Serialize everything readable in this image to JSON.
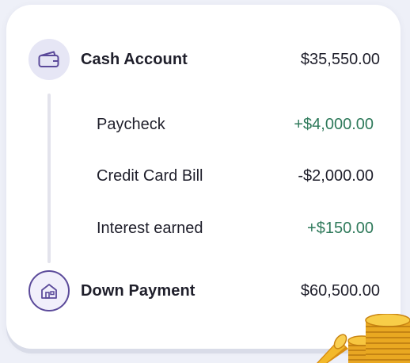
{
  "cash_account": {
    "icon": "wallet-icon",
    "label": "Cash Account",
    "value": "$35,550.00"
  },
  "transactions": [
    {
      "label": "Paycheck",
      "amount": "+$4,000.00",
      "type": "positive"
    },
    {
      "label": "Credit Card Bill",
      "amount": "-$2,000.00",
      "type": "negative"
    },
    {
      "label": "Interest earned",
      "amount": "+$150.00",
      "type": "positive"
    }
  ],
  "down_payment": {
    "icon": "house-icon",
    "label": "Down Payment",
    "value": "$60,500.00"
  },
  "colors": {
    "positive": "#2f7a5b",
    "text": "#1f1f2b",
    "accent": "#5b4a9a",
    "background": "#eef0f8",
    "coin": "#e8a623"
  },
  "decoration": "gold-coins-illustration"
}
